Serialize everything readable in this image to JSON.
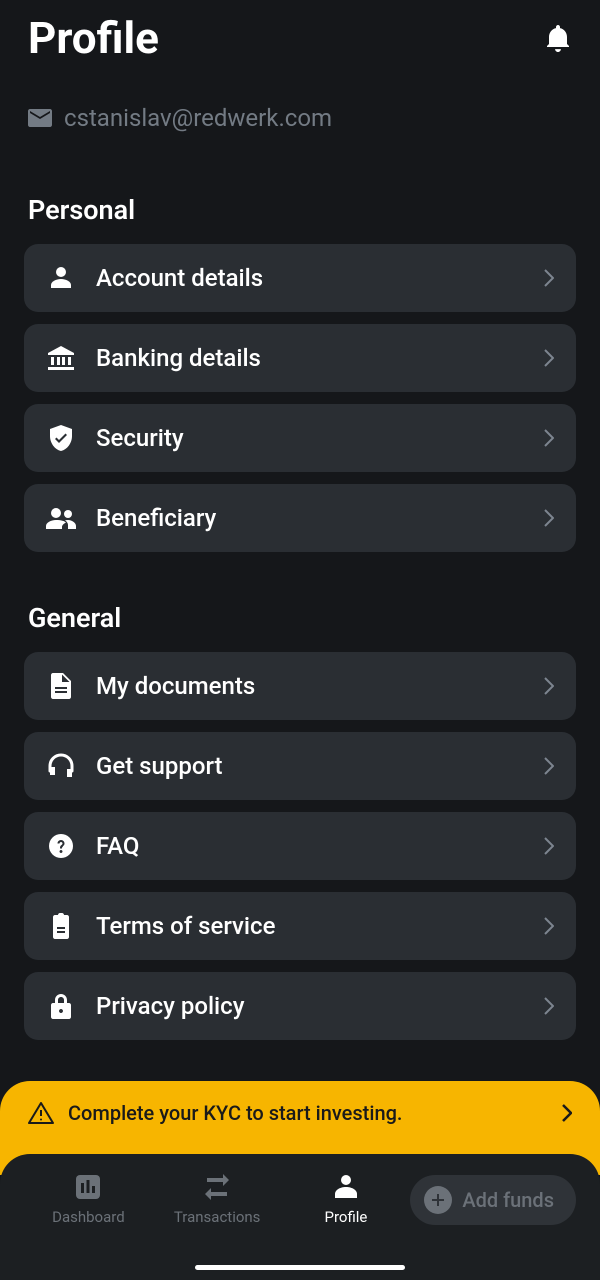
{
  "header": {
    "title": "Profile"
  },
  "email": "cstanislav@redwerk.com",
  "sections": {
    "personal": {
      "title": "Personal",
      "items": [
        {
          "label": "Account details"
        },
        {
          "label": "Banking details"
        },
        {
          "label": "Security"
        },
        {
          "label": "Beneficiary"
        }
      ]
    },
    "general": {
      "title": "General",
      "items": [
        {
          "label": "My documents"
        },
        {
          "label": "Get support"
        },
        {
          "label": "FAQ"
        },
        {
          "label": "Terms of service"
        },
        {
          "label": "Privacy policy"
        }
      ]
    }
  },
  "banner": {
    "text": "Complete your KYC to start investing."
  },
  "nav": {
    "items": [
      {
        "label": "Dashboard"
      },
      {
        "label": "Transactions"
      },
      {
        "label": "Profile"
      }
    ],
    "add_funds": "Add funds"
  }
}
